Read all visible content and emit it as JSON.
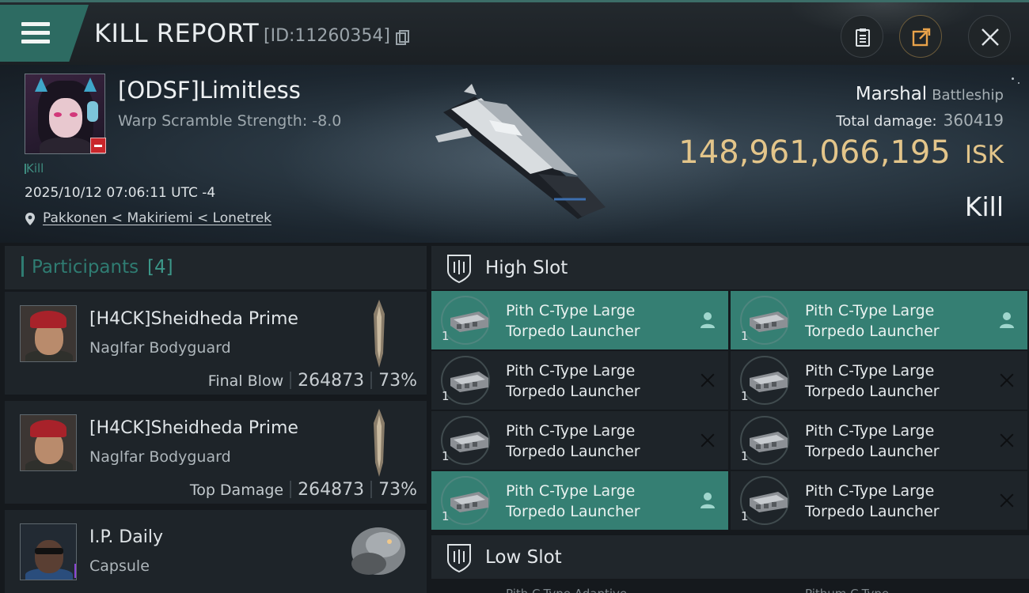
{
  "header": {
    "title": "KILL REPORT",
    "report_id": "[ID:11260354]",
    "menu_icon": "hamburger-icon",
    "buttons": [
      {
        "name": "clipboard-icon"
      },
      {
        "name": "share-icon"
      },
      {
        "name": "close-icon"
      }
    ]
  },
  "victim": {
    "name": "[ODSF]Limitless",
    "warp_scramble": "Warp Scramble Strength: -8.0",
    "kill_label": "Kill",
    "datetime": "2025/10/12 07:06:11 UTC -4",
    "location": "Pakkonen < Makiriemi < Lonetrek",
    "ship_name": "Marshal",
    "ship_class": "Battleship",
    "total_damage_label": "Total damage:",
    "total_damage": "360419",
    "isk_value": "148,961,066,195",
    "isk_unit": "ISK",
    "result": "Kill"
  },
  "participants": {
    "title": "Participants",
    "count": "[4]",
    "items": [
      {
        "name": "[H4CK]Sheidheda Prime",
        "ship": "Naglfar Bodyguard",
        "tag": "Final Blow",
        "damage": "264873",
        "percent": "73%"
      },
      {
        "name": "[H4CK]Sheidheda Prime",
        "ship": "Naglfar Bodyguard",
        "tag": "Top Damage",
        "damage": "264873",
        "percent": "73%"
      },
      {
        "name": "I.P. Daily",
        "ship": "Capsule"
      }
    ]
  },
  "slots": {
    "high": {
      "title": "High Slot",
      "modules": [
        {
          "line1": "Pith C-Type Large",
          "line2": "Torpedo Launcher",
          "qty": "1",
          "state": "equipped"
        },
        {
          "line1": "Pith C-Type Large",
          "line2": "Torpedo Launcher",
          "qty": "1",
          "state": "equipped"
        },
        {
          "line1": "Pith C-Type Large",
          "line2": "Torpedo Launcher",
          "qty": "1",
          "state": "destroyed"
        },
        {
          "line1": "Pith C-Type Large",
          "line2": "Torpedo Launcher",
          "qty": "1",
          "state": "destroyed"
        },
        {
          "line1": "Pith C-Type Large",
          "line2": "Torpedo Launcher",
          "qty": "1",
          "state": "destroyed"
        },
        {
          "line1": "Pith C-Type Large",
          "line2": "Torpedo Launcher",
          "qty": "1",
          "state": "destroyed"
        },
        {
          "line1": "Pith C-Type Large",
          "line2": "Torpedo Launcher",
          "qty": "1",
          "state": "equipped"
        },
        {
          "line1": "Pith C-Type Large",
          "line2": "Torpedo Launcher",
          "qty": "1",
          "state": "destroyed"
        }
      ]
    },
    "low": {
      "title": "Low Slot",
      "peek_a": "Pith C-Type Adaptive",
      "peek_b": "Pithum C-Type"
    }
  },
  "colors": {
    "accent": "#357f73",
    "isk": "#e3c58a",
    "muted_teal": "#2f7c72"
  }
}
